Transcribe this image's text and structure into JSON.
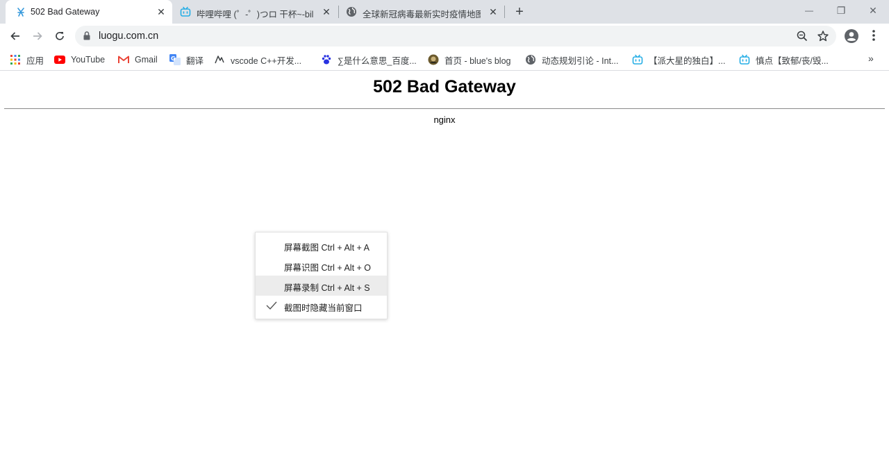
{
  "browser": {
    "tabs": [
      {
        "title": "502 Bad Gateway",
        "icon": "luogu-icon",
        "active": true
      },
      {
        "title": "哔哩哔哩 (゜-゜)つロ 干杯~-bilibili",
        "icon": "bilibili-icon",
        "active": false
      },
      {
        "title": "全球新冠病毒最新实时疫情地图",
        "icon": "globe-icon",
        "active": false
      }
    ],
    "new_tab_label": "+",
    "window_controls": {
      "minimize": "—",
      "maximize": "❐",
      "close": "✕"
    },
    "url": "luogu.com.cn"
  },
  "bookmarks": [
    {
      "label": "应用",
      "icon": "apps-grid-icon"
    },
    {
      "label": "YouTube",
      "icon": "youtube-icon"
    },
    {
      "label": "Gmail",
      "icon": "gmail-icon"
    },
    {
      "label": "翻译",
      "icon": "translate-icon"
    },
    {
      "label": "vscode C++开发...",
      "icon": "vscode-icon"
    },
    {
      "label": "∑是什么意思_百度...",
      "icon": "baidu-paw-icon"
    },
    {
      "label": "首页 - blue's blog",
      "icon": "avatar-icon"
    },
    {
      "label": "动态规划引论 - Int...",
      "icon": "globe-icon"
    },
    {
      "label": "【派大星的独白】...",
      "icon": "bilibili-icon"
    },
    {
      "label": "慎点【致郁/丧/毁...",
      "icon": "bilibili-icon"
    }
  ],
  "bookmarks_more": "»",
  "page": {
    "heading": "502 Bad Gateway",
    "server": "nginx"
  },
  "context_menu": {
    "items": [
      {
        "label": "屏幕截图 Ctrl + Alt + A",
        "checked": false,
        "highlighted": false
      },
      {
        "label": "屏幕识图 Ctrl + Alt + O",
        "checked": false,
        "highlighted": false
      },
      {
        "label": "屏幕录制 Ctrl + Alt + S",
        "checked": false,
        "highlighted": true
      },
      {
        "label": "截图时隐藏当前窗口",
        "checked": true,
        "highlighted": false
      }
    ]
  },
  "colors": {
    "tabstrip_bg": "#dee1e6",
    "omnibox_bg": "#f1f3f4",
    "bilibili": "#23ade5",
    "luogu": "#3498db"
  }
}
